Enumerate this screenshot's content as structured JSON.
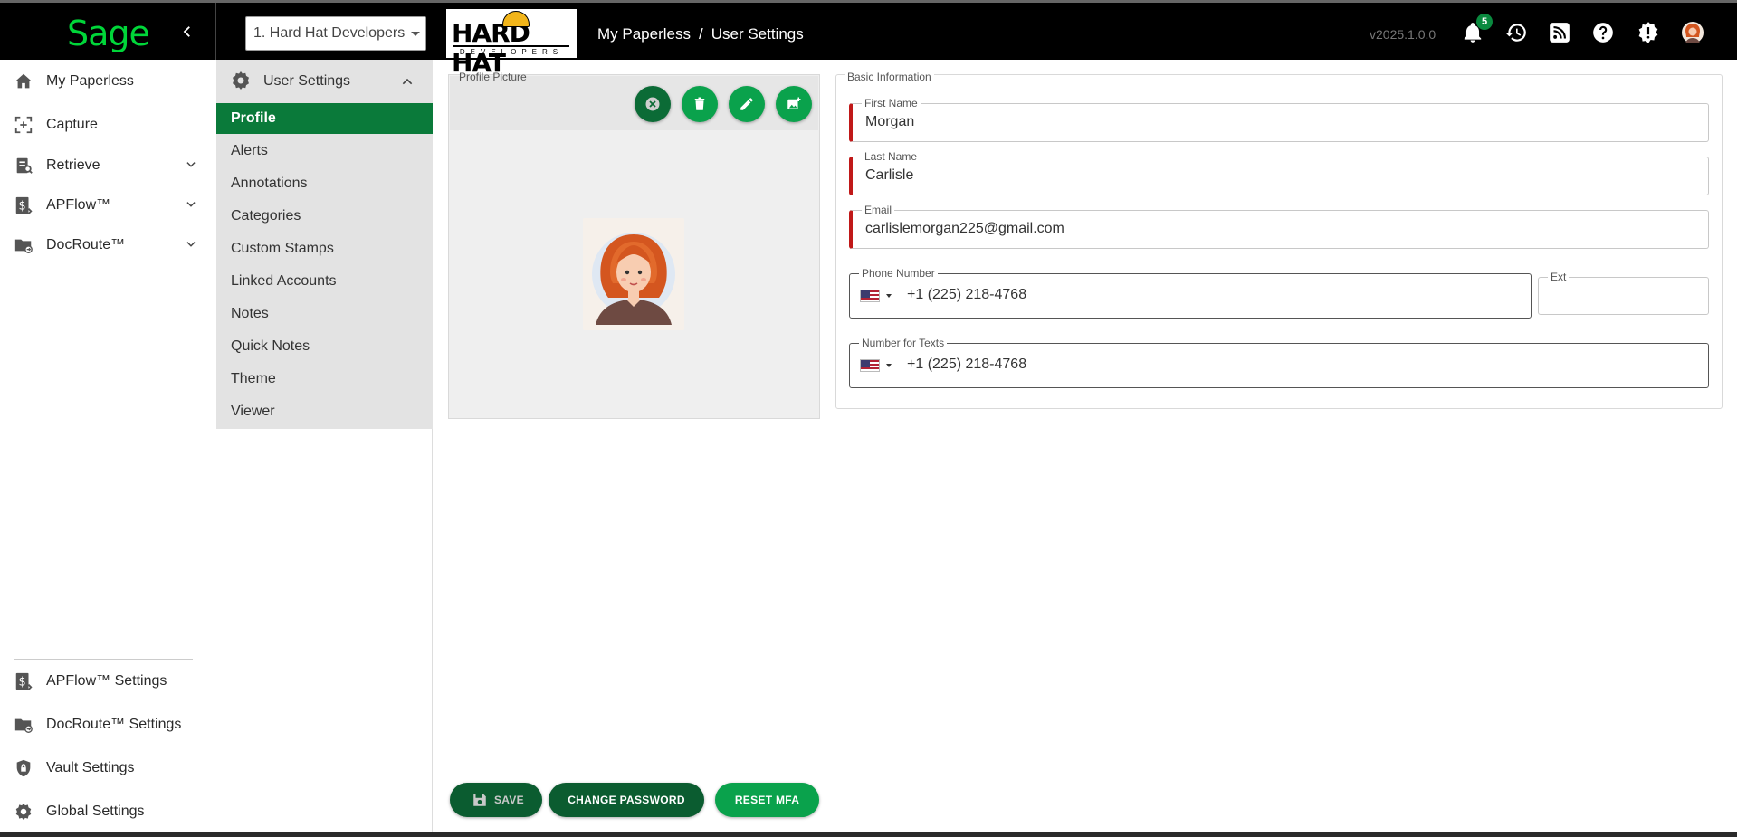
{
  "header": {
    "logo_text": "Sage",
    "org_select_value": "1. Hard Hat Developers",
    "brand_logo_text": "HARD HAT",
    "brand_logo_sub": "DEVELOPERS",
    "breadcrumb": [
      "My Paperless",
      "User Settings"
    ],
    "breadcrumb_sep": "/",
    "version": "v2025.1.0.0",
    "notification_count": "5",
    "icons": [
      "bell-icon",
      "history-icon",
      "rss-icon",
      "help-icon",
      "alert-gear-icon",
      "user-avatar"
    ]
  },
  "sidebar": {
    "items": [
      {
        "label": "My Paperless",
        "icon": "home-icon"
      },
      {
        "label": "Capture",
        "icon": "capture-icon"
      },
      {
        "label": "Retrieve",
        "icon": "retrieve-icon",
        "expandable": true
      },
      {
        "label": "APFlow™",
        "icon": "dollar-doc-icon",
        "expandable": true
      },
      {
        "label": "DocRoute™",
        "icon": "folder-route-icon",
        "expandable": true
      }
    ],
    "bottom_items": [
      {
        "label": "APFlow™ Settings",
        "icon": "dollar-doc-icon"
      },
      {
        "label": "DocRoute™ Settings",
        "icon": "folder-route-icon"
      },
      {
        "label": "Vault Settings",
        "icon": "shield-lock-icon"
      },
      {
        "label": "Global Settings",
        "icon": "gear-icon"
      }
    ]
  },
  "settings_nav": {
    "title": "User Settings",
    "items": [
      "Profile",
      "Alerts",
      "Annotations",
      "Categories",
      "Custom Stamps",
      "Linked Accounts",
      "Notes",
      "Quick Notes",
      "Theme",
      "Viewer"
    ],
    "active": "Profile"
  },
  "profile_picture": {
    "legend": "Profile Picture",
    "actions": [
      "clear-icon",
      "delete-icon",
      "edit-icon",
      "add-photo-icon"
    ]
  },
  "basic_info": {
    "legend": "Basic Information",
    "first_name_label": "First Name",
    "first_name": "Morgan",
    "last_name_label": "Last Name",
    "last_name": "Carlisle",
    "email_label": "Email",
    "email": "carlislemorgan225@gmail.com",
    "phone_label": "Phone Number",
    "phone": "+1 (225) 218-4768",
    "ext_label": "Ext",
    "ext": "",
    "text_number_label": "Number for Texts",
    "text_number": "+1 (225) 218-4768"
  },
  "actions": {
    "save": "SAVE",
    "change_password": "CHANGE PASSWORD",
    "reset_mfa": "RESET MFA"
  },
  "colors": {
    "brand_green": "#00d639",
    "active_green": "#0a7a3a",
    "button_dark_green": "#0b5c30",
    "button_green": "#0aa24c",
    "required_red": "#c01818"
  }
}
